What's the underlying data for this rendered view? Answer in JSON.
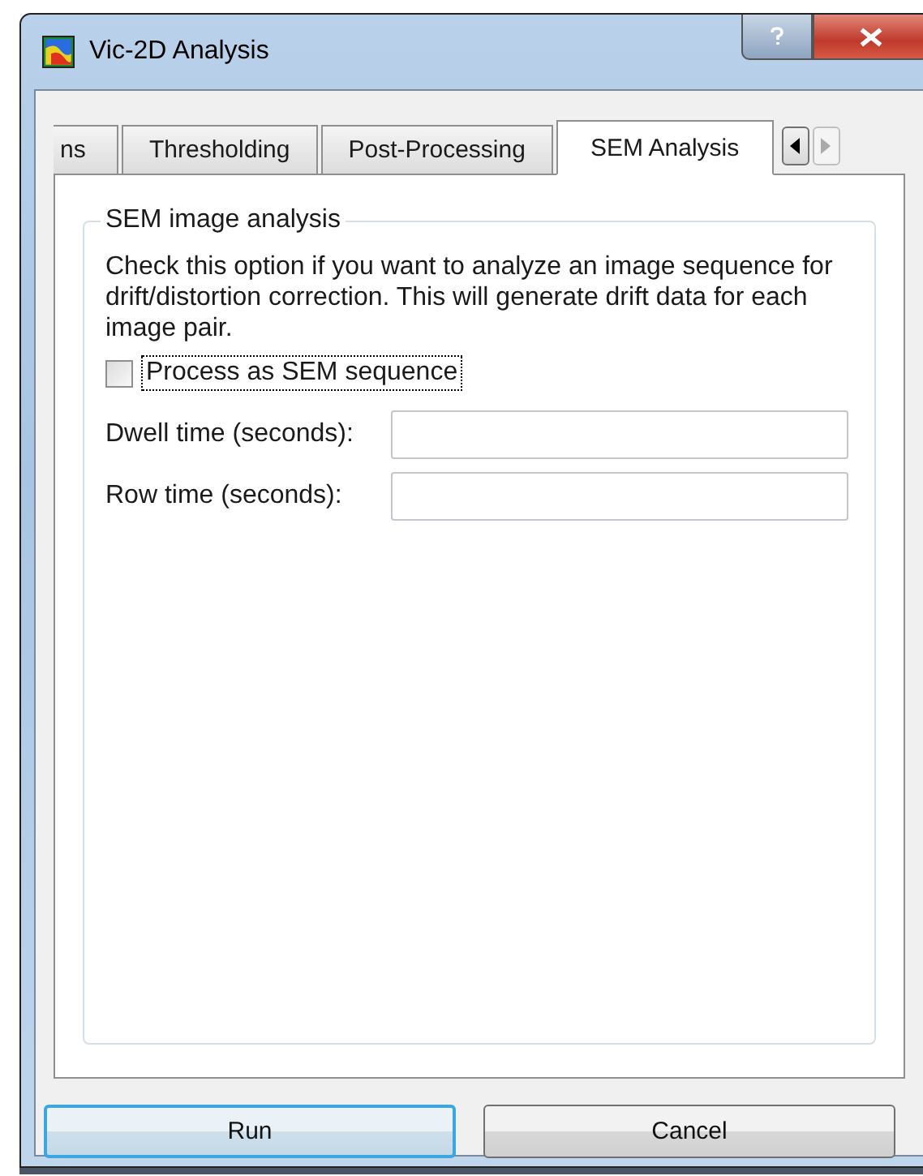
{
  "window": {
    "title": "Vic-2D Analysis"
  },
  "tabs": [
    {
      "label": "ns",
      "selected": false
    },
    {
      "label": "Thresholding",
      "selected": false
    },
    {
      "label": "Post-Processing",
      "selected": false
    },
    {
      "label": "SEM Analysis",
      "selected": true
    }
  ],
  "group": {
    "title": "SEM image analysis",
    "description": "Check this option if you want to analyze an image sequence for drift/distortion correction. This will generate drift data for each image pair.",
    "checkbox": {
      "label": "Process as SEM sequence",
      "checked": false
    },
    "fields": [
      {
        "label": "Dwell time (seconds):"
      },
      {
        "label": "Row time (seconds):"
      }
    ]
  },
  "buttons": [
    {
      "label": "Run",
      "selected": true
    },
    {
      "label": "Cancel",
      "selected": false
    }
  ]
}
